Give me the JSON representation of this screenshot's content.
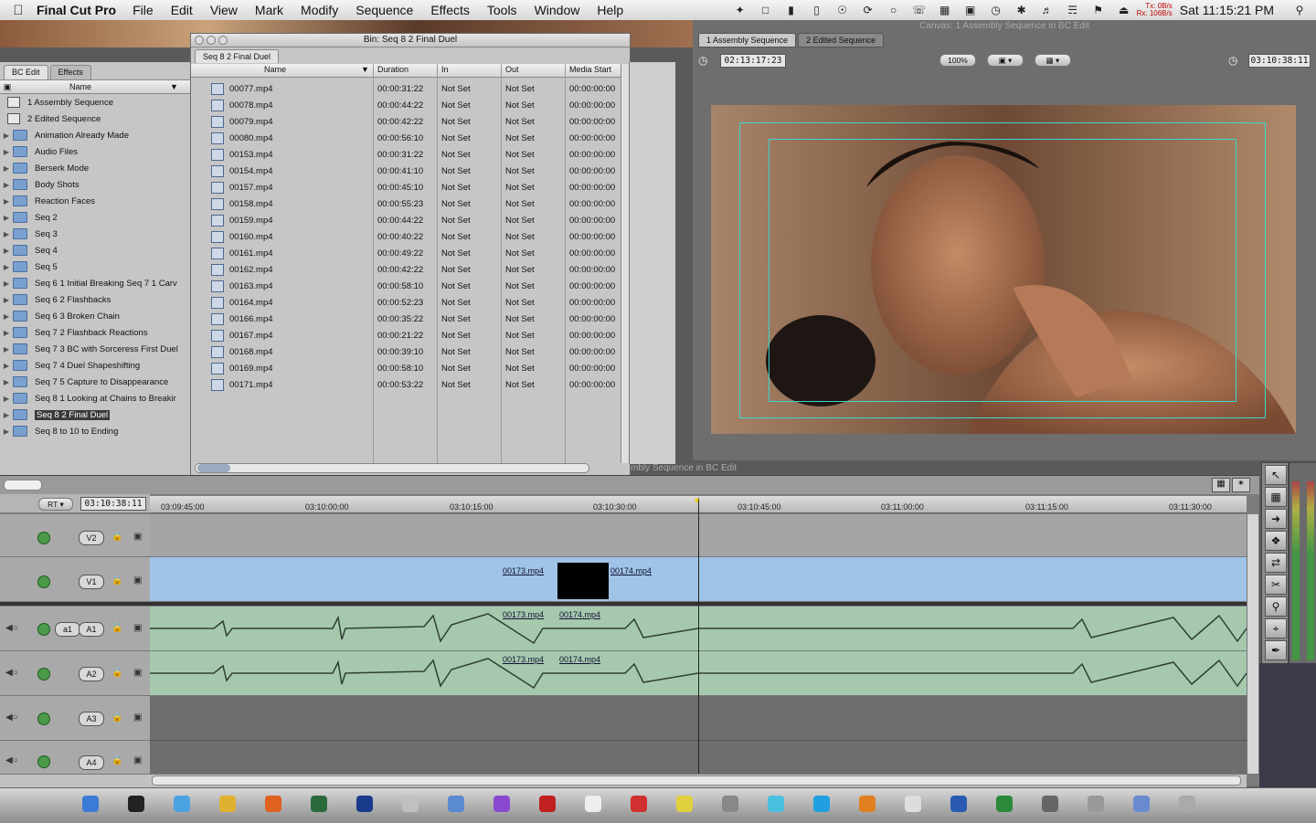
{
  "menubar": {
    "app_name": "Final Cut Pro",
    "items": [
      "File",
      "Edit",
      "View",
      "Mark",
      "Modify",
      "Sequence",
      "Effects",
      "Tools",
      "Window",
      "Help"
    ],
    "net_tx": "Tx:  0B/s",
    "net_rx": "Rx: 106B/s",
    "clock": "Sat 11:15:21 PM"
  },
  "browser": {
    "tabs": [
      "BC Edit",
      "Effects"
    ],
    "col_name": "Name",
    "items": [
      {
        "label": "1 Assembly Sequence",
        "kind": "sequence"
      },
      {
        "label": "2 Edited Sequence",
        "kind": "sequence"
      },
      {
        "label": "Animation Already Made",
        "kind": "bin"
      },
      {
        "label": "Audio Files",
        "kind": "bin"
      },
      {
        "label": "Berserk Mode",
        "kind": "bin"
      },
      {
        "label": "Body Shots",
        "kind": "bin"
      },
      {
        "label": "Reaction Faces",
        "kind": "bin"
      },
      {
        "label": "Seq 2",
        "kind": "bin"
      },
      {
        "label": "Seq 3",
        "kind": "bin"
      },
      {
        "label": "Seq 4",
        "kind": "bin"
      },
      {
        "label": "Seq 5",
        "kind": "bin"
      },
      {
        "label": "Seq 6 1 Initial Breaking Seq 7 1 Carv",
        "kind": "bin"
      },
      {
        "label": "Seq 6 2 Flashbacks",
        "kind": "bin"
      },
      {
        "label": "Seq 6 3 Broken Chain",
        "kind": "bin"
      },
      {
        "label": "Seq 7 2 Flashback Reactions",
        "kind": "bin"
      },
      {
        "label": "Seq 7 3 BC with Sorceress First Duel",
        "kind": "bin"
      },
      {
        "label": "Seq 7 4 Duel Shapeshifting",
        "kind": "bin"
      },
      {
        "label": "Seq 7 5 Capture to Disappearance",
        "kind": "bin"
      },
      {
        "label": "Seq 8 1 Looking at Chains to Breakir",
        "kind": "bin"
      },
      {
        "label": "Seq 8 2 Final Duel",
        "kind": "bin",
        "selected": true
      },
      {
        "label": "Seq 8 to 10 to Ending",
        "kind": "bin"
      }
    ]
  },
  "bin": {
    "title": "Bin: Seq 8 2 Final Duel",
    "tab": "Seq 8 2 Final Duel",
    "columns": {
      "name": "Name",
      "duration": "Duration",
      "in": "In",
      "out": "Out",
      "media_start": "Media Start"
    },
    "rows": [
      {
        "name": "00077.mp4",
        "duration": "00:00:31:22",
        "in": "Not Set",
        "out": "Not Set",
        "start": "00:00:00:00"
      },
      {
        "name": "00078.mp4",
        "duration": "00:00:44:22",
        "in": "Not Set",
        "out": "Not Set",
        "start": "00:00:00:00"
      },
      {
        "name": "00079.mp4",
        "duration": "00:00:42:22",
        "in": "Not Set",
        "out": "Not Set",
        "start": "00:00:00:00"
      },
      {
        "name": "00080.mp4",
        "duration": "00:00:56:10",
        "in": "Not Set",
        "out": "Not Set",
        "start": "00:00:00:00"
      },
      {
        "name": "00153.mp4",
        "duration": "00:00:31:22",
        "in": "Not Set",
        "out": "Not Set",
        "start": "00:00:00:00"
      },
      {
        "name": "00154.mp4",
        "duration": "00:00:41:10",
        "in": "Not Set",
        "out": "Not Set",
        "start": "00:00:00:00"
      },
      {
        "name": "00157.mp4",
        "duration": "00:00:45:10",
        "in": "Not Set",
        "out": "Not Set",
        "start": "00:00:00:00"
      },
      {
        "name": "00158.mp4",
        "duration": "00:00:55:23",
        "in": "Not Set",
        "out": "Not Set",
        "start": "00:00:00:00"
      },
      {
        "name": "00159.mp4",
        "duration": "00:00:44:22",
        "in": "Not Set",
        "out": "Not Set",
        "start": "00:00:00:00"
      },
      {
        "name": "00160.mp4",
        "duration": "00:00:40:22",
        "in": "Not Set",
        "out": "Not Set",
        "start": "00:00:00:00"
      },
      {
        "name": "00161.mp4",
        "duration": "00:00:49:22",
        "in": "Not Set",
        "out": "Not Set",
        "start": "00:00:00:00"
      },
      {
        "name": "00162.mp4",
        "duration": "00:00:42:22",
        "in": "Not Set",
        "out": "Not Set",
        "start": "00:00:00:00"
      },
      {
        "name": "00163.mp4",
        "duration": "00:00:58:10",
        "in": "Not Set",
        "out": "Not Set",
        "start": "00:00:00:00"
      },
      {
        "name": "00164.mp4",
        "duration": "00:00:52:23",
        "in": "Not Set",
        "out": "Not Set",
        "start": "00:00:00:00"
      },
      {
        "name": "00166.mp4",
        "duration": "00:00:35:22",
        "in": "Not Set",
        "out": "Not Set",
        "start": "00:00:00:00"
      },
      {
        "name": "00167.mp4",
        "duration": "00:00:21:22",
        "in": "Not Set",
        "out": "Not Set",
        "start": "00:00:00:00"
      },
      {
        "name": "00168.mp4",
        "duration": "00:00:39:10",
        "in": "Not Set",
        "out": "Not Set",
        "start": "00:00:00:00"
      },
      {
        "name": "00169.mp4",
        "duration": "00:00:58:10",
        "in": "Not Set",
        "out": "Not Set",
        "start": "00:00:00:00"
      },
      {
        "name": "00171.mp4",
        "duration": "00:00:53:22",
        "in": "Not Set",
        "out": "Not Set",
        "start": "00:00:00:00"
      }
    ]
  },
  "canvas": {
    "title": "Canvas: 1 Assembly Sequence in BC Edit",
    "tabs": [
      "1 Assembly Sequence",
      "2 Edited Sequence"
    ],
    "duration_tc": "02:13:17:23",
    "zoom": "100%",
    "current_tc": "03:10:38:11"
  },
  "timeline": {
    "title": "mbly Sequence in BC Edit",
    "rt_label": "RT",
    "current_tc": "03:10:38:11",
    "ruler": [
      "03:09:45:00",
      "03:10:00:00",
      "03:10:15:00",
      "03:10:30:00",
      "03:10:45:00",
      "03:11:00:00",
      "03:11:15:00",
      "03:11:30:00"
    ],
    "tracks": {
      "v2": "V2",
      "v1": "V1",
      "a1_src": "a1",
      "a1": "A1",
      "a2": "A2",
      "a3": "A3",
      "a4": "A4"
    },
    "clips": {
      "c173": "00173.mp4",
      "c174": "00174.mp4"
    }
  },
  "colors": {
    "accent": "#9fc4e8",
    "audio": "#a6c9ae",
    "video_bg": "#6b4830"
  }
}
